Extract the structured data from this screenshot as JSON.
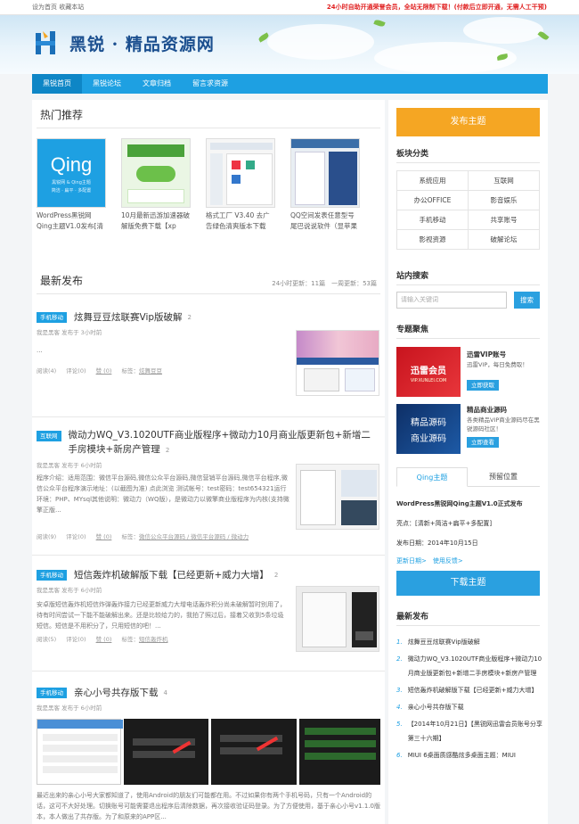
{
  "topbar": {
    "left": "设为首页 收藏本站",
    "right": "24小时自助开通荣誉会员，全站无限制下载！(付款后立即开通，无需人工干预)"
  },
  "logo": {
    "text": "黑锐 · 精品资源网"
  },
  "nav": [
    "黑锐首页",
    "黑锐论坛",
    "文章归档",
    "留言求资源"
  ],
  "hot": {
    "title": "热门推荐",
    "thumb_qing": "Qing",
    "thumb_qing_sub": "黑锐网 & Qing主题",
    "thumb_qing_sub2": "简洁 · 扁平 · 多配置",
    "items": [
      "WordPress黑锐网Qing主题V1.0发布[清新+简",
      "10月最新迅游加速器破解版免费下载【xp win7",
      "格式工厂 V3.40 去广告绿色清爽版本下载",
      "QQ空间发表任意型号尾巴说说软件（显苹果6）"
    ]
  },
  "latest": {
    "title": "最新发布",
    "meta": "24小时更新：11篇　一周更新：53篇"
  },
  "posts": [
    {
      "tag": "手机移动",
      "title": "炫舞豆豆炫联赛Vip版破解",
      "count": "2",
      "byline": "我是黑客  发布于  3小时前",
      "excerpt": "...",
      "views": "阅读(4)",
      "comments": "评论(0)",
      "likes": "赞 (0)",
      "tags_label": "标签：",
      "tags": "炫舞豆豆"
    },
    {
      "tag": "互联网",
      "title": "微动力WQ_V3.1020UTF商业版程序+微动力10月商业版更新包+新增二手房模块+新房产管理",
      "count": "2",
      "byline": "我是黑客  发布于  6小时前",
      "excerpt": "程序介绍：适用范围：微信平台源码,微信公众平台源码,微信营销平台源码,微信平台程序,微信公众平台程序演示地址：(以截图为准) 点此浏览 测试帐号：test密码：test654321运行环境：PHP、MYsql其他说明：微动力（WQ版），是微动力以微擎商业版程序为内核(支持微擎正版...",
      "views": "阅读(9)",
      "comments": "评论(0)",
      "likes": "赞 (0)",
      "tags_label": "标签：",
      "tags": "微信公众平台源码 / 微信平台源码 / 微动力"
    },
    {
      "tag": "手机移动",
      "title": "短信轰炸机破解版下载【已经更新+威力大增】",
      "count": "2",
      "byline": "我是黑客  发布于  6小时前",
      "excerpt": "安卓版短信轰炸机短信炸弹轰炸接力已经更新威力大增电话轰炸积分尚未破解暂时别用了，待有时间尝试一下能不能破解出来。还是比较给力的，我拍了照过后，接着又收到5条垃圾短信。短信是不用积分了，只用短信的吧！...",
      "views": "阅读(5)",
      "comments": "评论(0)",
      "likes": "赞 (0)",
      "tags_label": "标签：",
      "tags": "短信轰炸机"
    },
    {
      "tag": "手机移动",
      "title": "亲心小号共存版下载",
      "count": "4",
      "byline": "我是黑客  发布于  6小时前",
      "excerpt": "最近出来的亲心小号大家都知道了，使用Android的朋友们可能都在用。不过如果你有两个手机号码，只有一个Android的话，这可不大好处理。切换账号可能需要退出程序后清除数据，再次接收验证码登录。为了方便使用，基于亲心小号v1.1.0版本，本人做出了共存版。为了和原来的APP区..."
    }
  ],
  "sidebar": {
    "publish": "发布主题",
    "board_title": "板块分类",
    "boards": [
      "系统应用",
      "互联网",
      "办公OFFICE",
      "影音娱乐",
      "手机移动",
      "共享账号",
      "影视资源",
      "破解论坛"
    ],
    "search_title": "站内搜索",
    "search_placeholder": "请输入关键词",
    "search_btn": "搜索",
    "focus_title": "专题聚焦",
    "focus": [
      {
        "title": "迅雷VIP账号",
        "desc": "迅雷VIP，每日免费取！",
        "btn": "立即获取",
        "img_text": "迅雷会员",
        "img_sub": "VIP.XUNLEI.COM"
      },
      {
        "title": "精品商业源码",
        "desc": "各类精品VIP商业源码尽在黑锐源码社区！",
        "btn": "立即查看",
        "img_text": "精品源码",
        "img_text2": "商业源码"
      }
    ],
    "tabs": [
      "Qing主题",
      "预留位置"
    ],
    "qing_title": "WordPress黑锐网Qing主题V1.0正式发布",
    "qing_feature": "亮点：[清新+简洁+扁平+多配置]",
    "qing_date": "发布日期：2014年10月15日",
    "qing_links": "更新日期>　使用反馈>",
    "download": "下载主题",
    "recent_title": "最新发布",
    "recent": [
      "炫舞豆豆炫联赛Vip版破解",
      "微动力WQ_V3.1020UTF商业版程序+微动力10月商业版更新包+新增二手房模块+新房产管理",
      "短信轰炸机破解版下载【已经更新+威力大增】",
      "亲心小号共存版下载",
      "【2014年10月21日】【黑锐网迅雷会员账号分享第三十六期】",
      "MIUI 6桌面质感酷炫多桌面主题：MIUI"
    ]
  }
}
